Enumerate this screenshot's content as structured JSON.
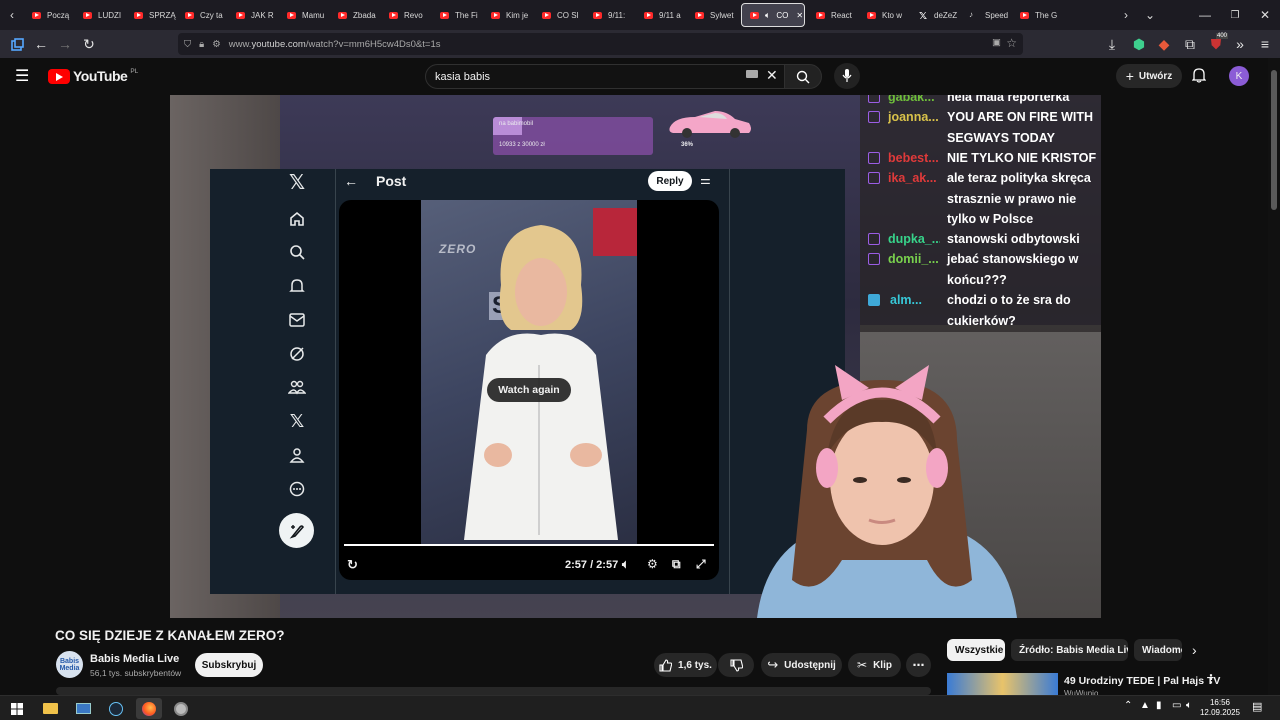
{
  "browser": {
    "tabs": [
      {
        "label": "Począ",
        "icon": "youtube-icon"
      },
      {
        "label": "LUDZI",
        "icon": "youtube-icon"
      },
      {
        "label": "SPRZĄ",
        "icon": "youtube-icon"
      },
      {
        "label": "Czy ta",
        "icon": "youtube-icon"
      },
      {
        "label": "JAK R",
        "icon": "youtube-icon"
      },
      {
        "label": "Mamu",
        "icon": "youtube-icon"
      },
      {
        "label": "Zbada",
        "icon": "youtube-icon"
      },
      {
        "label": "Revo",
        "icon": "youtube-icon"
      },
      {
        "label": "The Fi",
        "icon": "youtube-icon"
      },
      {
        "label": "Kim je",
        "icon": "youtube-icon"
      },
      {
        "label": "CO SI",
        "icon": "youtube-icon"
      },
      {
        "label": "9/11:",
        "icon": "youtube-icon"
      },
      {
        "label": "9/11 a",
        "icon": "youtube-icon"
      },
      {
        "label": "Sylwet",
        "icon": "youtube-icon"
      },
      {
        "label": "CO",
        "icon": "youtube-icon",
        "active": true
      },
      {
        "label": "React",
        "icon": "youtube-icon"
      },
      {
        "label": "Kto w",
        "icon": "youtube-icon"
      },
      {
        "label": "deZeZ",
        "icon": "x-icon"
      },
      {
        "label": "Speed",
        "icon": "tiktok-icon"
      },
      {
        "label": "The G",
        "icon": "youtube-icon"
      }
    ],
    "url_prefix": "www.",
    "url_domain": "youtube.com",
    "url_path": "/watch?v=mm6H5cw4Ds0&t=1s",
    "badge_count": "400"
  },
  "youtube": {
    "logo_text": "YouTube",
    "region": "PL",
    "search_query": "kasia babis",
    "create_label": "Utwórz",
    "avatar_letter": "K"
  },
  "stream": {
    "goal_label": "na babimobil",
    "goal_amount": "10933 z 30000 zł",
    "goal_percent": "36%",
    "goal_fraction": 0.36
  },
  "x_post": {
    "header": "Post",
    "reply_label": "Reply",
    "watch_again": "Watch again",
    "time": "2:57 / 2:57",
    "overlay_brand": "ZERO",
    "overlay_brand2": "ST"
  },
  "chat": [
    {
      "user": "gabak...",
      "color": "#6fbf3a",
      "text": "neia maia reporterka"
    },
    {
      "user": "joanna...",
      "color": "#d9c24a",
      "text": "YOU ARE ON FIRE WITH SEGWAYS TODAY"
    },
    {
      "user": "bebest...",
      "color": "#e03a3a",
      "text": "NIE TYLKO NIE KRISTOF"
    },
    {
      "user": "ika_ak...",
      "color": "#e03a3a",
      "text": "ale teraz polityka skręca strasznie w prawo nie tylko w Polsce"
    },
    {
      "user": "dupka_...",
      "color": "#37d38a",
      "text": "stanowski odbytowski"
    },
    {
      "user": "domii_...",
      "color": "#79d14d",
      "text": "jebać stanowskiego w końcu???"
    },
    {
      "user": "alm...",
      "color": "#37c8d8",
      "text": "chodzi o to że sra do cukierków?"
    }
  ],
  "video": {
    "title": "CO SIĘ DZIEJE Z KANAŁEM ZERO?",
    "channel": "Babis Media Live",
    "channel_avatar_text": "Babis Media",
    "subscribers": "56,1 tys. subskrybentów",
    "subscribe_label": "Subskrybuj",
    "likes": "1,6 tys.",
    "share_label": "Udostępnij",
    "clip_label": "Klip"
  },
  "chips": [
    "Wszystkie",
    "Źródło: Babis Media Live",
    "Wiadomości"
  ],
  "recommended": {
    "title": "49 Urodziny TEDE | Pal Hajs TV",
    "channel": "WuWunio"
  },
  "taskbar": {
    "time": "16:56",
    "date": "12.09.2025"
  }
}
